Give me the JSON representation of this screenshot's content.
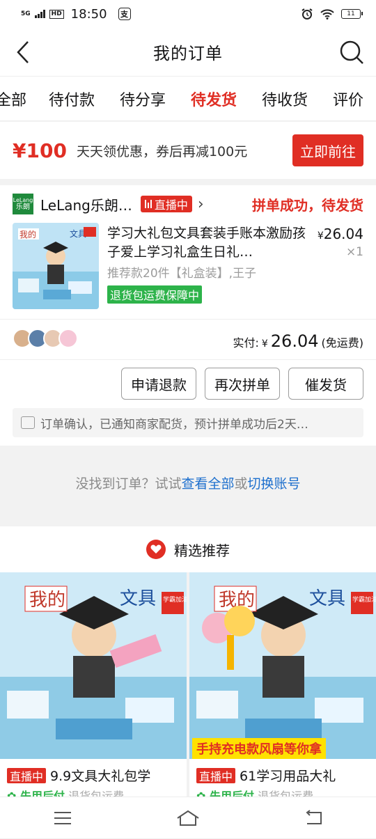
{
  "status_bar": {
    "network": "5G",
    "hd": "HD",
    "time": "18:50",
    "app_badge": "支",
    "battery": "11"
  },
  "header": {
    "title": "我的订单"
  },
  "tabs": [
    {
      "label": "全部"
    },
    {
      "label": "待付款"
    },
    {
      "label": "待分享"
    },
    {
      "label": "待发货",
      "active": true
    },
    {
      "label": "待收货"
    },
    {
      "label": "评价"
    }
  ],
  "promo": {
    "amount": "¥100",
    "text": "天天领优惠，券后再减100元",
    "button": "立即前往"
  },
  "order": {
    "shop_logo_top": "LeLang",
    "shop_logo_bottom": "乐朗",
    "shop_name": "LeLang乐朗…",
    "live_label": "直播中",
    "status": "拼单成功，待发货",
    "product_title": "学习大礼包文具套装手账本激励孩子爱上学习礼盒生日礼…",
    "price_symbol": "¥",
    "price": "26.04",
    "quantity": "×1",
    "spec": "推荐款20件【礼盒装】,王子",
    "guarantee": "退货包运费保障中",
    "paid_label": "实付:",
    "paid_symbol": "¥",
    "paid_amount": "26.04",
    "shipping": "(免运费)",
    "buttons": [
      "申请退款",
      "再次拼单",
      "催发货"
    ],
    "notice": "订单确认，已通知商家配货，预计拼单成功后2天…"
  },
  "not_found": {
    "prefix": "没找到订单？试试",
    "link1": "查看全部",
    "mid": "或",
    "link2": "切换账号"
  },
  "recommend": {
    "title": "精选推荐"
  },
  "cards": [
    {
      "live": "直播中",
      "title": "9.9文具大礼包学",
      "sub_green": "✿ 先用后付",
      "sub_gray": "退货包运费",
      "img_text1": "我的",
      "img_text2": "文具",
      "img_badge": "学霸加油"
    },
    {
      "live": "直播中",
      "title": "61学习用品大礼",
      "sub_green": "✿ 先用后付",
      "sub_gray": "退货包运费",
      "img_text1": "我的",
      "img_text2": "文具",
      "img_badge": "学霸加油",
      "banner": "手持充电款风扇等你拿"
    }
  ],
  "colors": {
    "accent": "#e02e24",
    "green": "#2db34a",
    "link": "#1d6fcd"
  }
}
